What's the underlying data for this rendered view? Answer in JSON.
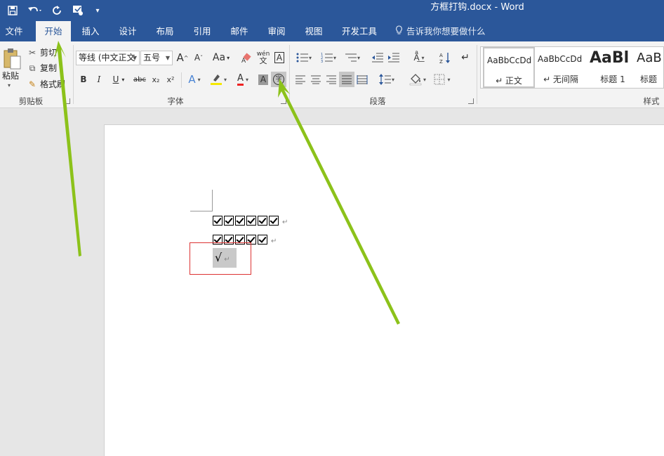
{
  "titlebar": {
    "title": "方框打钩.docx - Word",
    "quick_access": [
      "save-icon",
      "undo-icon",
      "redo-icon",
      "touch-mode-icon",
      "customize-icon"
    ]
  },
  "tabs": [
    {
      "label": "文件"
    },
    {
      "label": "开始",
      "active": true
    },
    {
      "label": "插入"
    },
    {
      "label": "设计"
    },
    {
      "label": "布局"
    },
    {
      "label": "引用"
    },
    {
      "label": "邮件"
    },
    {
      "label": "审阅"
    },
    {
      "label": "视图"
    },
    {
      "label": "开发工具"
    }
  ],
  "tell_me": "告诉我你想要做什么",
  "ribbon": {
    "clipboard": {
      "paste_label": "粘贴",
      "cut_label": "剪切",
      "copy_label": "复制",
      "format_painter_label": "格式刷",
      "group_label": "剪贴板"
    },
    "font": {
      "font_name": "等线 (中文正文",
      "font_size": "五号",
      "group_label": "字体",
      "bold": "B",
      "italic": "I",
      "underline": "U",
      "strikethrough": "abc",
      "subscript": "x₂",
      "superscript": "x²",
      "change_case": "Aa",
      "phonetic": "wén",
      "char_border": "A",
      "enclose_char": "字",
      "grow_font": "A",
      "shrink_font": "A",
      "text_effects": "A",
      "font_color": "A",
      "char_shading": "A"
    },
    "paragraph": {
      "group_label": "段落"
    },
    "styles": {
      "group_label": "样式",
      "items": [
        {
          "preview": "AaBbCcDd",
          "name": "↵ 正文"
        },
        {
          "preview": "AaBbCcDd",
          "name": "↵ 无间隔"
        },
        {
          "preview": "AaBl",
          "name": "标题 1"
        },
        {
          "preview": "AaB",
          "name": "标题"
        }
      ]
    }
  },
  "document": {
    "line1_checkboxes": 6,
    "line2_checkboxes": 5,
    "check_mark": "√",
    "para_mark": "↵"
  },
  "colors": {
    "accent": "#2b579a",
    "arrow": "#8cc21a",
    "selection_box": "#dd3333"
  }
}
